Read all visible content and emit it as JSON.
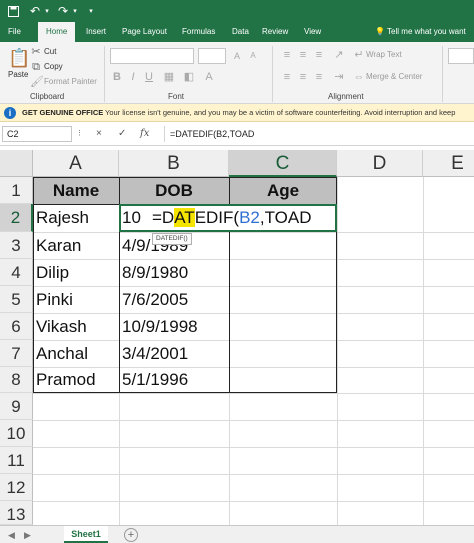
{
  "quick_access": {
    "save_icon": "save-icon",
    "undo_icon": "undo-icon",
    "redo_icon": "redo-icon"
  },
  "ribbon_tabs": [
    "File",
    "Home",
    "Insert",
    "Page Layout",
    "Formulas",
    "Data",
    "Review",
    "View"
  ],
  "active_tab": "Home",
  "tell_me": "Tell me what you want",
  "ribbon": {
    "clipboard": {
      "paste": "Paste",
      "cut": "Cut",
      "copy": "Copy",
      "format_painter": "Format Painter",
      "label": "Clipboard"
    },
    "font": {
      "bold": "B",
      "italic": "I",
      "underline": "U",
      "label": "Font"
    },
    "alignment": {
      "wrap_text": "Wrap Text",
      "merge_center": "Merge & Center",
      "label": "Alignment"
    }
  },
  "message_bar": {
    "title": "GET GENUINE OFFICE",
    "text": "Your license isn't genuine, and you may be a victim of software counterfeiting. Avoid interruption and keep"
  },
  "formula_bar": {
    "name_box": "C2",
    "cancel": "×",
    "enter": "✓",
    "fx": "fx",
    "formula": "=DATEDIF(B2,TOAD"
  },
  "columns": [
    "A",
    "B",
    "C",
    "D",
    "E"
  ],
  "rows": [
    "1",
    "2",
    "3",
    "4",
    "5",
    "6",
    "7",
    "8",
    "9",
    "10",
    "11",
    "12",
    "13"
  ],
  "table": {
    "headers": [
      "Name",
      "DOB",
      "Age"
    ],
    "rows": [
      [
        "Rajesh",
        "10"
      ],
      [
        "Karan",
        "4/9/1989"
      ],
      [
        "Dilip",
        "8/9/1980"
      ],
      [
        "Pinki",
        "7/6/2005"
      ],
      [
        "Vikash",
        "10/9/1998"
      ],
      [
        "Anchal",
        "3/4/2001"
      ],
      [
        "Pramod",
        "5/1/1996"
      ]
    ]
  },
  "edit": {
    "p1": "=D",
    "p2": "AT",
    "p3": "EDIF(",
    "p4": "B2",
    "p5": ",TOAD"
  },
  "tooltip": "DATEDIF()",
  "sheet_tab": "Sheet1",
  "add_sheet": "+"
}
